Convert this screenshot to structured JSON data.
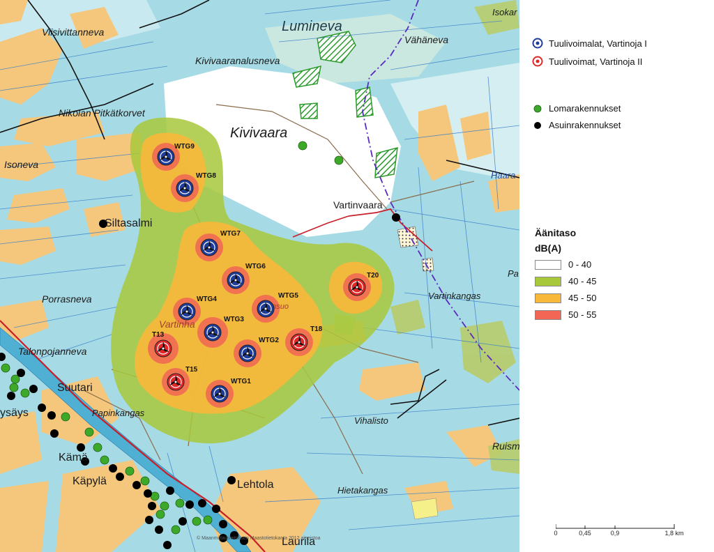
{
  "map": {
    "place_names": [
      {
        "text": "Viisivittanneva"
      },
      {
        "text": "Lumineva"
      },
      {
        "text": "Vähäneva"
      },
      {
        "text": "Isokar"
      },
      {
        "text": "Kivivaaranalusneva"
      },
      {
        "text": "Nikolan Pitkätkorvet"
      },
      {
        "text": "Kivivaara"
      },
      {
        "text": "Isoneva"
      },
      {
        "text": "Haara"
      },
      {
        "text": "Vartinvaara"
      },
      {
        "text": "Siltasalmi"
      },
      {
        "text": "Porrasneva"
      },
      {
        "text": "Vartinkangas"
      },
      {
        "text": "Pa"
      },
      {
        "text": "Vartinha"
      },
      {
        "text": "Talonpojanneva"
      },
      {
        "text": "Suutari"
      },
      {
        "text": "ysäys"
      },
      {
        "text": "Papinkangas"
      },
      {
        "text": "Vihalisto"
      },
      {
        "text": "Ruism"
      },
      {
        "text": "Kämä"
      },
      {
        "text": "Käpylä"
      },
      {
        "text": "Lehtola"
      },
      {
        "text": "Hietakangas"
      },
      {
        "text": "Laurila"
      },
      {
        "text": "Rauasuo"
      }
    ],
    "turbines": [
      {
        "id": "WTG9",
        "group": "I"
      },
      {
        "id": "WTG8",
        "group": "I"
      },
      {
        "id": "WTG7",
        "group": "I"
      },
      {
        "id": "WTG6",
        "group": "I"
      },
      {
        "id": "WTG5",
        "group": "I"
      },
      {
        "id": "WTG4",
        "group": "I"
      },
      {
        "id": "WTG3",
        "group": "I"
      },
      {
        "id": "WTG2",
        "group": "I"
      },
      {
        "id": "WTG1",
        "group": "I"
      },
      {
        "id": "T20",
        "group": "II"
      },
      {
        "id": "T18",
        "group": "II"
      },
      {
        "id": "T13",
        "group": "II"
      },
      {
        "id": "T15",
        "group": "II"
      }
    ],
    "copyright": "© Maanmittauslaitoksen Maastotietokanta 2012 aineistoa"
  },
  "legend": {
    "turbines_1": "Tuulivoimalat, Vartinoja I",
    "turbines_2": "Tuulivoimat, Vartinoja II",
    "holiday": "Lomarakennukset",
    "residential": "Asuinrakennukset",
    "title": "Äänitaso",
    "unit": "dB(A)",
    "ranges": [
      {
        "label": "0 - 40",
        "color": "#ffffff"
      },
      {
        "label": "40 - 45",
        "color": "#a8c83c"
      },
      {
        "label": "45 - 50",
        "color": "#f8b83a"
      },
      {
        "label": "50 - 55",
        "color": "#f26655"
      }
    ],
    "turbine_1_color": "#1f3c9a",
    "turbine_2_color": "#e02828",
    "holiday_color": "#3caa28",
    "residential_color": "#000000"
  },
  "scalebar": {
    "ticks": [
      "0",
      "0,45",
      "0,9",
      "1,8 km"
    ]
  }
}
